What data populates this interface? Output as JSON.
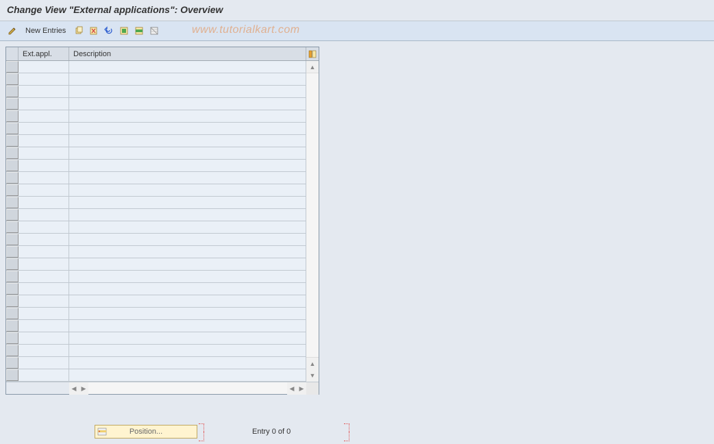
{
  "header": {
    "title": "Change View \"External applications\": Overview"
  },
  "toolbar": {
    "edit_label": "",
    "new_entries_label": "New Entries",
    "icons": {
      "edit": "pencil-icon",
      "copy": "copy-icon",
      "delete": "delete-icon",
      "undo": "undo-icon",
      "select_all": "select-all-icon",
      "select_block": "select-block-icon",
      "deselect": "deselect-icon"
    }
  },
  "watermark": "www.tutorialkart.com",
  "table": {
    "columns": {
      "ext_appl": "Ext.appl.",
      "description": "Description"
    },
    "row_count": 26,
    "rows": []
  },
  "footer": {
    "position_label": "Position...",
    "entry_text": "Entry 0 of 0"
  }
}
